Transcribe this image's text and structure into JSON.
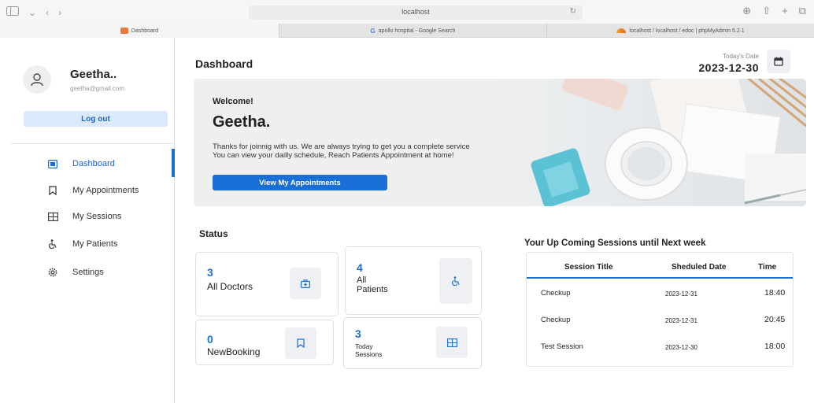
{
  "browser": {
    "url": "localhost",
    "tabs": [
      {
        "title": "Dashboard"
      },
      {
        "title": "apollo hospital - Google Search"
      },
      {
        "title": "localhost / localhost / edoc | phpMyAdmin 5.2.1"
      }
    ]
  },
  "sidebar": {
    "user_name": "Geetha..",
    "user_email": "geetha@gmail.com",
    "logout_label": "Log out",
    "items": [
      {
        "label": "Dashboard",
        "icon": "dashboard-icon",
        "active": true
      },
      {
        "label": "My Appointments",
        "icon": "bookmark-icon"
      },
      {
        "label": "My Sessions",
        "icon": "sessions-icon"
      },
      {
        "label": "My Patients",
        "icon": "wheelchair-icon"
      },
      {
        "label": "Settings",
        "icon": "gear-icon"
      }
    ]
  },
  "header": {
    "title": "Dashboard",
    "date_label": "Today's Date",
    "date_value": "2023-12-30"
  },
  "banner": {
    "welcome": "Welcome!",
    "name": "Geetha.",
    "line1": "Thanks for joinnig with us. We are always trying to get you a complete service",
    "line2": "You can view your dailly schedule, Reach Patients Appointment at home!",
    "button_label": "View My Appointments"
  },
  "status": {
    "title": "Status",
    "cards": [
      {
        "count": "3",
        "label": "All Doctors",
        "icon": "doctor-bag-icon"
      },
      {
        "count": "4",
        "label_line1": "All",
        "label_line2": "Patients",
        "icon": "wheelchair-icon"
      },
      {
        "count": "0",
        "label": "NewBooking",
        "icon": "bookmark-icon"
      },
      {
        "count": "3",
        "label_line1": "Today",
        "label_line2": "Sessions",
        "icon": "sessions-icon"
      }
    ]
  },
  "sessions": {
    "title": "Your Up Coming Sessions until Next week",
    "columns": [
      "Session Title",
      "Sheduled Date",
      "Time"
    ],
    "rows": [
      {
        "title": "Checkup",
        "date": "2023-12-31",
        "time": "18:40"
      },
      {
        "title": "Checkup",
        "date": "2023-12-31",
        "time": "20:45"
      },
      {
        "title": "Test Session",
        "date": "2023-12-30",
        "time": "18:00"
      }
    ]
  },
  "colors": {
    "accent": "#1a6fd6",
    "logout_bg": "#dbeafb",
    "icon_box_bg": "#eef0f4"
  }
}
